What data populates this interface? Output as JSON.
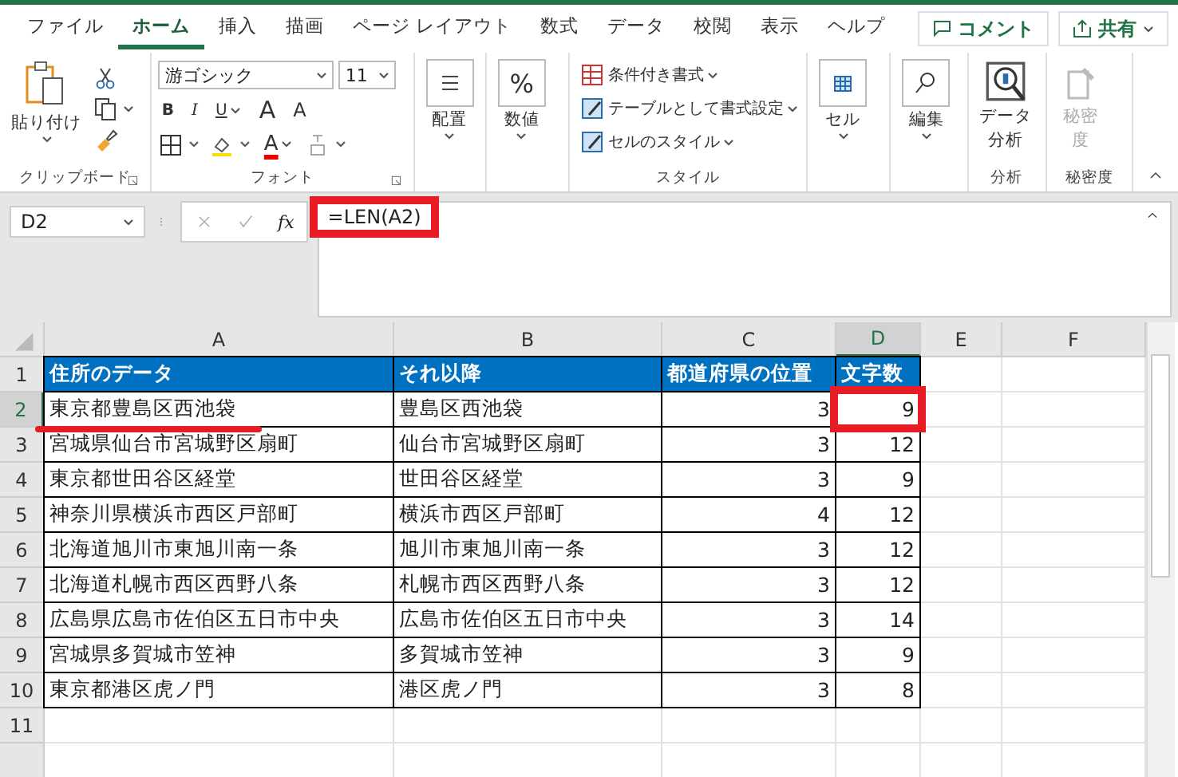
{
  "tabs": [
    {
      "label": "ファイル",
      "selected": false
    },
    {
      "label": "ホーム",
      "selected": true
    },
    {
      "label": "挿入",
      "selected": false
    },
    {
      "label": "描画",
      "selected": false
    },
    {
      "label": "ページ レイアウト",
      "selected": false
    },
    {
      "label": "数式",
      "selected": false
    },
    {
      "label": "データ",
      "selected": false
    },
    {
      "label": "校閲",
      "selected": false
    },
    {
      "label": "表示",
      "selected": false
    },
    {
      "label": "ヘルプ",
      "selected": false
    }
  ],
  "comment_button": "コメント",
  "share_button": "共有",
  "ribbon": {
    "clipboard": {
      "paste": "貼り付け",
      "label": "クリップボード"
    },
    "font": {
      "name": "游ゴシック",
      "size": "11",
      "bold": "B",
      "italic": "I",
      "underline": "U",
      "grow": "A",
      "shrink": "A",
      "color_button": "A",
      "label": "フォント"
    },
    "alignment": "配置",
    "number_icon": "%",
    "number": "数値",
    "styles": {
      "items": [
        "条件付き書式",
        "テーブルとして書式設定",
        "セルのスタイル"
      ],
      "label": "スタイル"
    },
    "cells": "セル",
    "editing": "編集",
    "analysis": {
      "button": [
        "データ",
        "分析"
      ],
      "label": "分析"
    },
    "sensitivity": {
      "button": [
        "秘密",
        "度"
      ],
      "disabled": true,
      "label": "秘密度"
    }
  },
  "formula_bar": {
    "name_box": "D2",
    "fx": "fx",
    "formula": "=LEN(A2)",
    "highlighted": true
  },
  "columns": [
    {
      "label": "A",
      "selected": false
    },
    {
      "label": "B",
      "selected": false
    },
    {
      "label": "C",
      "selected": false
    },
    {
      "label": "D",
      "selected": true
    },
    {
      "label": "E",
      "selected": false
    },
    {
      "label": "F",
      "selected": false
    }
  ],
  "rows": [
    {
      "number": "1",
      "selected": false,
      "kind": "header",
      "cells": [
        {
          "text": "住所のデータ"
        },
        {
          "text": "それ以降"
        },
        {
          "text": "都道府県の位置"
        },
        {
          "text": "文字数"
        }
      ]
    },
    {
      "number": "2",
      "selected": true,
      "kind": "data",
      "cells": [
        {
          "text": "東京都豊島区西池袋",
          "underlined": true
        },
        {
          "text": "豊島区西池袋"
        },
        {
          "text": "3",
          "kind": "number"
        },
        {
          "text": "9",
          "kind": "number",
          "boxed": true
        }
      ]
    },
    {
      "number": "3",
      "selected": false,
      "kind": "data",
      "cells": [
        {
          "text": "宮城県仙台市宮城野区扇町"
        },
        {
          "text": "仙台市宮城野区扇町"
        },
        {
          "text": "3",
          "kind": "number"
        },
        {
          "text": "12",
          "kind": "number"
        }
      ]
    },
    {
      "number": "4",
      "selected": false,
      "kind": "data",
      "cells": [
        {
          "text": "東京都世田谷区経堂"
        },
        {
          "text": "世田谷区経堂"
        },
        {
          "text": "3",
          "kind": "number"
        },
        {
          "text": "9",
          "kind": "number"
        }
      ]
    },
    {
      "number": "5",
      "selected": false,
      "kind": "data",
      "cells": [
        {
          "text": "神奈川県横浜市西区戸部町"
        },
        {
          "text": "横浜市西区戸部町"
        },
        {
          "text": "4",
          "kind": "number"
        },
        {
          "text": "12",
          "kind": "number"
        }
      ]
    },
    {
      "number": "6",
      "selected": false,
      "kind": "data",
      "cells": [
        {
          "text": "北海道旭川市東旭川南一条"
        },
        {
          "text": "旭川市東旭川南一条"
        },
        {
          "text": "3",
          "kind": "number"
        },
        {
          "text": "12",
          "kind": "number"
        }
      ]
    },
    {
      "number": "7",
      "selected": false,
      "kind": "data",
      "cells": [
        {
          "text": "北海道札幌市西区西野八条"
        },
        {
          "text": "札幌市西区西野八条"
        },
        {
          "text": "3",
          "kind": "number"
        },
        {
          "text": "12",
          "kind": "number"
        }
      ]
    },
    {
      "number": "8",
      "selected": false,
      "kind": "data",
      "cells": [
        {
          "text": "広島県広島市佐伯区五日市中央"
        },
        {
          "text": "広島市佐伯区五日市中央"
        },
        {
          "text": "3",
          "kind": "number"
        },
        {
          "text": "14",
          "kind": "number"
        }
      ]
    },
    {
      "number": "9",
      "selected": false,
      "kind": "data",
      "cells": [
        {
          "text": "宮城県多賀城市笠神"
        },
        {
          "text": "多賀城市笠神"
        },
        {
          "text": "3",
          "kind": "number"
        },
        {
          "text": "9",
          "kind": "number"
        }
      ]
    },
    {
      "number": "10",
      "selected": false,
      "kind": "data",
      "cells": [
        {
          "text": "東京都港区虎ノ門"
        },
        {
          "text": "港区虎ノ門"
        },
        {
          "text": "3",
          "kind": "number"
        },
        {
          "text": "8",
          "kind": "number"
        }
      ]
    },
    {
      "number": "11",
      "selected": false,
      "kind": "empty",
      "cells": []
    }
  ]
}
